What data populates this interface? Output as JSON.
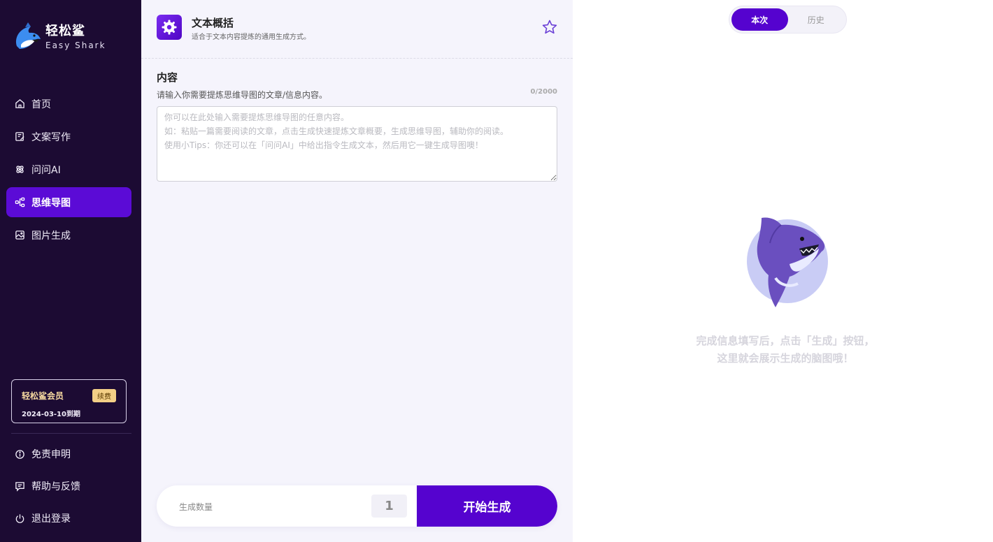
{
  "brand": {
    "name": "轻松鲨",
    "subtitle": "Easy Shark"
  },
  "nav": {
    "items": [
      {
        "label": "首页",
        "icon": "home-icon"
      },
      {
        "label": "文案写作",
        "icon": "document-edit-icon"
      },
      {
        "label": "问问AI",
        "icon": "ai-chat-icon"
      },
      {
        "label": "思维导图",
        "icon": "mindmap-icon",
        "active": true
      },
      {
        "label": "图片生成",
        "icon": "image-icon"
      }
    ]
  },
  "membership": {
    "title": "轻松鲨会员",
    "renew_label": "续费",
    "expiry": "2024-03-10到期"
  },
  "bottom_nav": {
    "items": [
      {
        "label": "免责申明",
        "icon": "info-icon"
      },
      {
        "label": "帮助与反馈",
        "icon": "feedback-icon"
      },
      {
        "label": "退出登录",
        "icon": "power-icon"
      }
    ]
  },
  "tool": {
    "title": "文本概括",
    "description": "适合于文本内容提炼的通用生成方式。"
  },
  "content": {
    "title": "内容",
    "hint": "请输入你需要提炼思维导图的文章/信息内容。",
    "char_count": "0/2000",
    "value": "",
    "placeholder": "你可以在此处输入需要提炼思维导图的任意内容。\n如：粘贴一篇需要阅读的文章，点击生成快速提炼文章概要，生成思维导图，辅助你的阅读。\n使用小Tips：你还可以在「问问AI」中给出指令生成文本，然后用它一键生成导图噢！"
  },
  "generate": {
    "count_label": "生成数量",
    "count_value": "1",
    "button_label": "开始生成"
  },
  "result": {
    "tabs": [
      {
        "label": "本次",
        "active": true
      },
      {
        "label": "历史",
        "active": false
      }
    ],
    "empty_line1": "完成信息填写后，点击「生成」按钮，",
    "empty_line2": "这里就会展示生成的脑图哦！"
  },
  "colors": {
    "sidebar_bg": "#1c0b33",
    "accent": "#5503cf",
    "panel_bg": "#f5f4fc",
    "gold": "#f3cf86"
  }
}
